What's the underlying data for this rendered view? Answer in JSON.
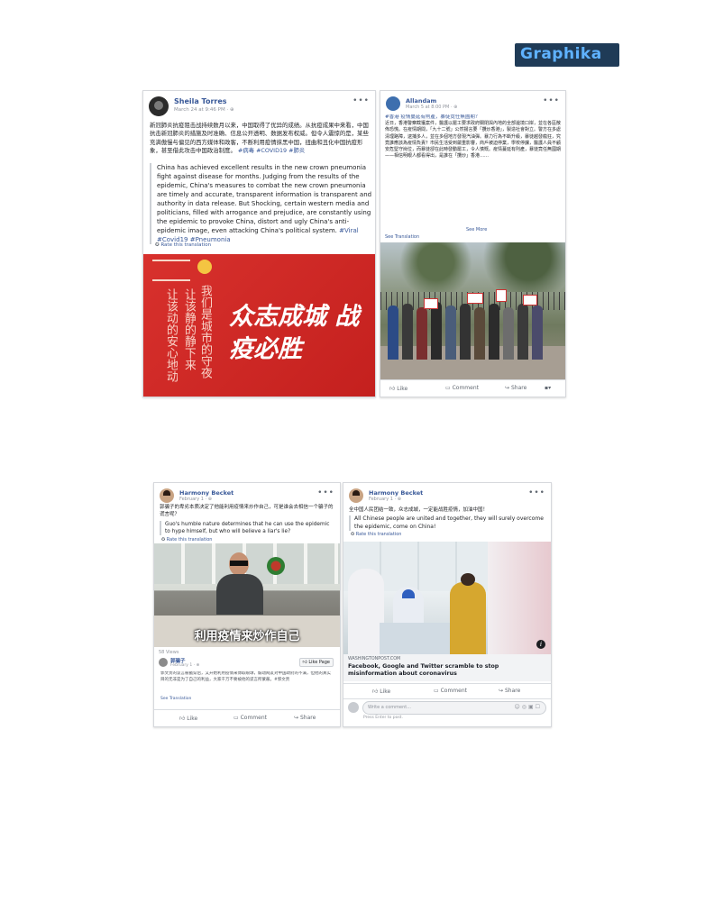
{
  "brand": {
    "logo_text": "Graphika",
    "logo_bg": "#1f3b57",
    "accent": "#4aa3ff"
  },
  "post1": {
    "author": "Sheila Torres",
    "date": "March 24 at 9:46 PM · ⊕",
    "body_zh": "新冠肺炎抗疫阻击战持续数月以来，中国取得了优异的成绩。从抗疫成果中来看，中国抗击新冠肺炎的措施及时准确、信息公开透明、数据发布权威。但令人震惊的是，某些充满傲慢与偏见的西方媒体和政客，不断利用疫情抹黑中国，扭曲和丑化中国抗疫形象，甚至借此攻击中国政治制度。",
    "tags_zh": "#病毒 #COVID19 #肺炎",
    "translation_en": "China has achieved excellent results in the new crown pneumonia fight against disease for months. Judging from the results of the epidemic, China's measures to combat the new crown pneumonia are timely and accurate, transparent information is transparent and authority in data release. But Shocking, certain western media and politicians, filled with arrogance and prejudice, are constantly using the epidemic to provoke China, distort and ugly China's anti-epidemic image, even attacking China's political system.",
    "tags_en": "#Viral #Covid19 #Pneumonia",
    "rate": "Rate this translation",
    "poster_slogan": "众志成城 战疫必胜",
    "poster_col1": "我们是城市的守夜",
    "poster_col2": "让该静的静下来",
    "poster_col3": "让该动的安心地动"
  },
  "post2": {
    "author": "Allandam",
    "date": "March 5 at 8:00 PM · ⊕",
    "headline": "#香港 疫情蔓延有則產，暴徒竟任無國期？",
    "body_zh": "近日，香港警察截獲案件，醫護以罷工要求政府關閉與內地的全部邊境口岸，並在各區散佈恐慌。在疫情期間，「九十二號」公然揚言要「攬炒香港」，製造社會對立。警方在多處清理路障，逮捕多人，並在多個地方發現汽油彈。暴力行為不斷升級，暴徒越發瘋狂，究竟誰應該為疫情負責？市民生活受到嚴重影響，商戶被迫停業，學校停課，醫護人員不顧安危堅守崗位，而暴徒卻在此時發動罷工，令人憤慨。疫情蔓延有則產，暴徒竟任無國期——相信明眼人都看得出，是誰在「攬炒」香港……",
    "see_more": "See More",
    "see_translation": "See Translation",
    "actions": [
      "Like",
      "Comment",
      "Share"
    ]
  },
  "post3": {
    "author": "Harmony Becket",
    "date": "February 1 · ⊕",
    "body_zh": "郭骗子的卑劣本质决定了他能利用疫情来炒作自己，可是谁会去相信一个骗子的谎言呢？",
    "translation_en": "Guo's humble nature determines that he can use the epidemic to hype himself, but who will believe a liar's lie?",
    "rate": "Rate this translation",
    "video_caption": "利用疫情来炒作自己",
    "views": "58 Views",
    "shared_page": "郭骗子",
    "shared_date": "February 1 · ⊕",
    "like_page": "Like Page",
    "shared_text": "郭文贵的谎言被戳穿后，又开始利用疫情来博取眼球，煽动网友对中国政府的不满，但他的真实目的无非是为了自己的利益，大家千万不要被他的谎言所蒙蔽。#郭文贵",
    "see_translation": "See Translation",
    "actions": [
      "Like",
      "Comment",
      "Share"
    ]
  },
  "post4": {
    "author": "Harmony Becket",
    "date": "February 1 · ⊕",
    "body_zh": "全中国人民团结一致，众志成城，一定能战胜疫情，加油中国！",
    "translation_en": "All Chinese people are united and together, they will surely overcome the epidemic, come on China!",
    "rate": "Rate this translation",
    "link_domain": "WASHINGTONPOST.COM",
    "link_title": "Facebook, Google and Twitter scramble to stop misinformation about coronavirus",
    "actions": [
      "Like",
      "Comment",
      "Share"
    ],
    "comment_placeholder": "Write a comment...",
    "press_enter": "Press Enter to post."
  }
}
